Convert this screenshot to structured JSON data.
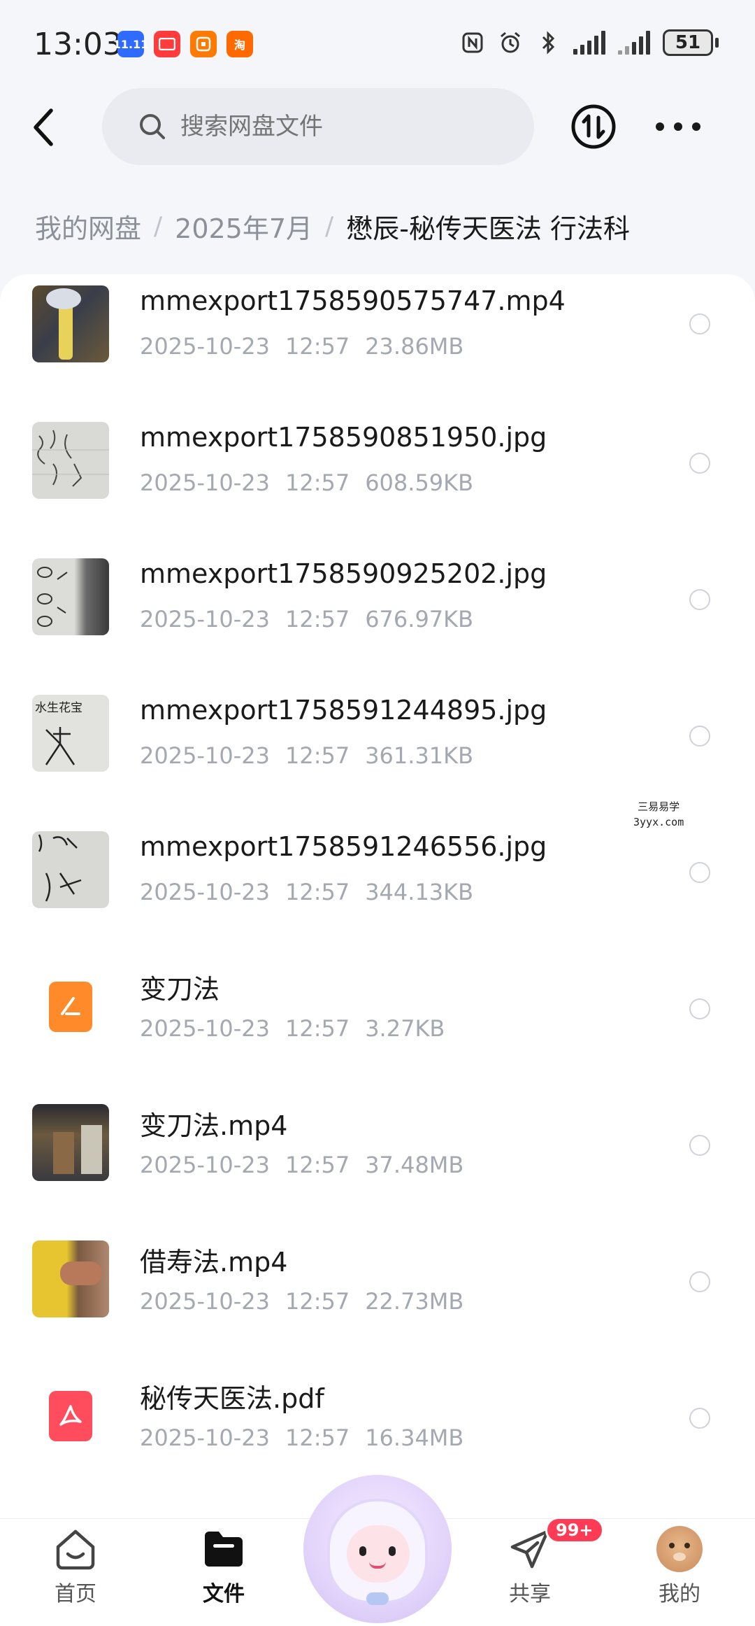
{
  "status_bar": {
    "time": "13:03",
    "apps": [
      {
        "icon": "calendar-app-icon",
        "text": "11.11",
        "color": "#2f6bff"
      },
      {
        "icon": "red-app-icon",
        "text": "",
        "color": "#ff3b3b"
      },
      {
        "icon": "orange-app-icon",
        "text": "",
        "color": "#ff7a00"
      },
      {
        "icon": "taobao-app-icon",
        "text": "淘",
        "color": "#ff6a00"
      }
    ],
    "battery": "51"
  },
  "header": {
    "search_placeholder": "搜索网盘文件"
  },
  "breadcrumb": {
    "items": [
      "我的网盘",
      "2025年7月",
      "懋辰-秘传天医法 行法科"
    ]
  },
  "files": [
    {
      "name": "mmexport1758590575747.mp4",
      "date": "2025-10-23",
      "time": "12:57",
      "size": "23.86MB",
      "kind": "video"
    },
    {
      "name": "mmexport1758590851950.jpg",
      "date": "2025-10-23",
      "time": "12:57",
      "size": "608.59KB",
      "kind": "image"
    },
    {
      "name": "mmexport1758590925202.jpg",
      "date": "2025-10-23",
      "time": "12:57",
      "size": "676.97KB",
      "kind": "image"
    },
    {
      "name": "mmexport1758591244895.jpg",
      "date": "2025-10-23",
      "time": "12:57",
      "size": "361.31KB",
      "kind": "image",
      "thumb_text": "水生花宝"
    },
    {
      "name": "mmexport1758591246556.jpg",
      "date": "2025-10-23",
      "time": "12:57",
      "size": "344.13KB",
      "kind": "image"
    },
    {
      "name": "变刀法",
      "date": "2025-10-23",
      "time": "12:57",
      "size": "3.27KB",
      "kind": "doc"
    },
    {
      "name": "变刀法.mp4",
      "date": "2025-10-23",
      "time": "12:57",
      "size": "37.48MB",
      "kind": "video"
    },
    {
      "name": "借寿法.mp4",
      "date": "2025-10-23",
      "time": "12:57",
      "size": "22.73MB",
      "kind": "video"
    },
    {
      "name": "秘传天医法.pdf",
      "date": "2025-10-23",
      "time": "12:57",
      "size": "16.34MB",
      "kind": "pdf"
    }
  ],
  "watermark": {
    "line1": "三易易学",
    "line2": "3yyx.com"
  },
  "bottom_nav": {
    "home": "首页",
    "files": "文件",
    "share": "共享",
    "share_badge": "99+",
    "mine": "我的"
  },
  "colors": {
    "doc_icon": "#ff8a2a",
    "pdf_icon": "#ff4d5e",
    "badge": "#ff3b55"
  }
}
